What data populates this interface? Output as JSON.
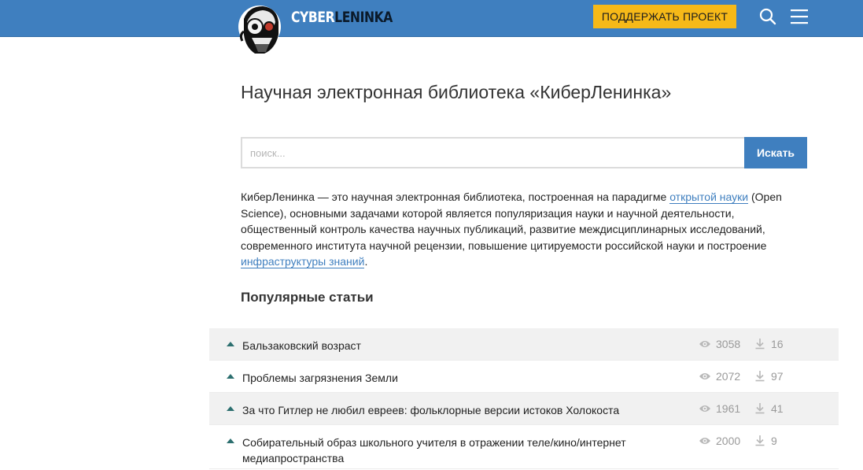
{
  "header": {
    "logo_text_light": "CYBER",
    "logo_text_dark": "LENINKA",
    "support_label": "ПОДДЕРЖАТЬ ПРОЕКТ",
    "icons": [
      "search-icon",
      "menu-icon"
    ]
  },
  "main": {
    "title": "Научная электронная библиотека «КиберЛенинка»",
    "search": {
      "placeholder": "поиск...",
      "button_label": "Искать"
    },
    "intro": {
      "part1": "КиберЛенинка — это научная электронная библиотека, построенная на парадигме ",
      "link1": "открытой науки",
      "part2": " (Open Science), основными задачами которой является популяризация науки и научной деятельности, общественный контроль качества научных публикаций, развитие междисциплинарных исследований, современного института научной рецензии, повышение цитируемости российской науки и построение ",
      "link2": "инфраструктуры знаний",
      "part3": "."
    },
    "popular_title": "Популярные статьи",
    "articles": [
      {
        "title": "Бальзаковский возраст",
        "views": "3058",
        "downloads": "16"
      },
      {
        "title": "Проблемы загрязнения Земли",
        "views": "2072",
        "downloads": "97"
      },
      {
        "title": "За что Гитлер не любил евреев: фольклорные версии истоков Холокоста",
        "views": "1961",
        "downloads": "41"
      },
      {
        "title": "Собирательный образ школьного учителя в отражении теле/кино/интернет медиапространства",
        "views": "2000",
        "downloads": "9"
      }
    ]
  },
  "colors": {
    "header_blue": "#3f7fbf",
    "support_yellow": "#f6b918",
    "link_blue": "#3f7fbf",
    "triangle_teal": "#2c6f6f"
  }
}
